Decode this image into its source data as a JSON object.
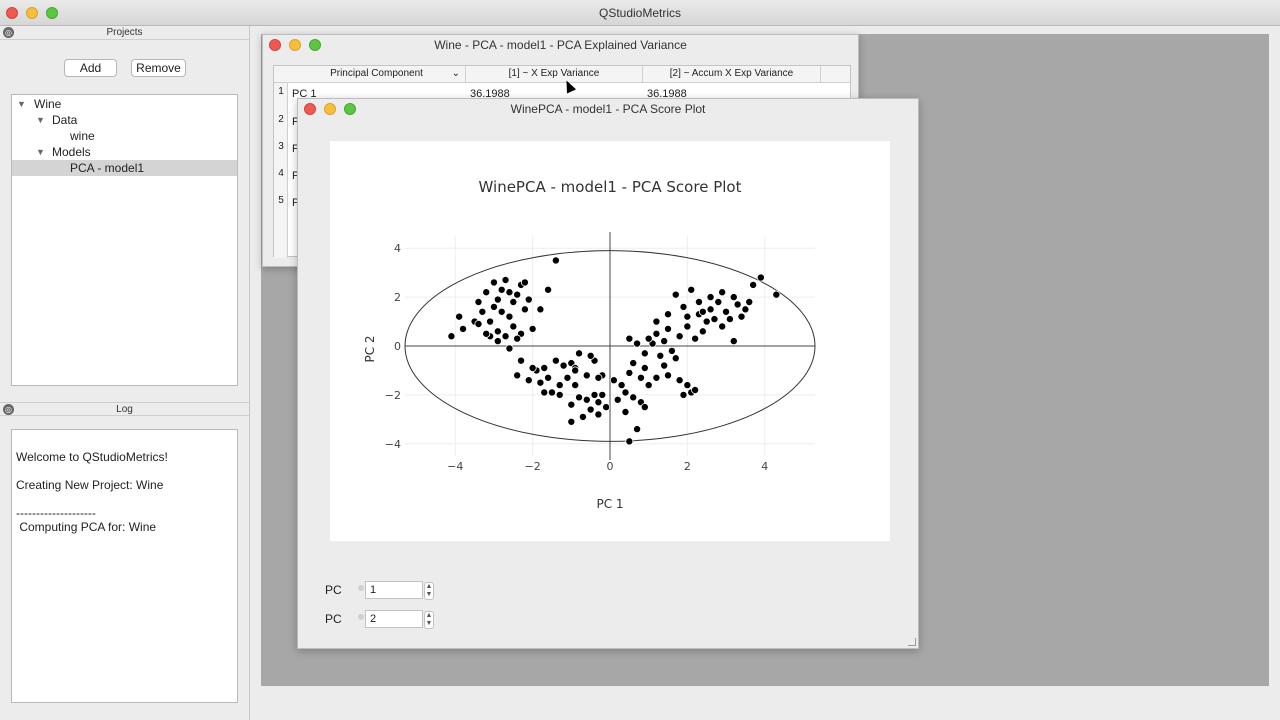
{
  "app": {
    "title": "QStudioMetrics"
  },
  "projects_panel": {
    "title": "Projects",
    "add_label": "Add",
    "remove_label": "Remove",
    "tree": [
      {
        "label": "Wine",
        "depth": 0,
        "expanded": true
      },
      {
        "label": "Data",
        "depth": 1,
        "expanded": true
      },
      {
        "label": "wine",
        "depth": 2
      },
      {
        "label": "Models",
        "depth": 1,
        "expanded": true
      },
      {
        "label": "PCA - model1",
        "depth": 2,
        "selected": true
      }
    ]
  },
  "log_panel": {
    "title": "Log",
    "lines": [
      "Welcome to QStudioMetrics!",
      "Creating New Project: Wine",
      "--------------------",
      " Computing PCA for: Wine"
    ]
  },
  "variance_window": {
    "title": "Wine - PCA - model1 - PCA Explained Variance",
    "columns": [
      "Principal Component",
      "[1] ~ X Exp Variance",
      "[2] ~ Accum X Exp Variance"
    ],
    "rows": [
      {
        "num": "1",
        "pc": "PC 1",
        "x": "36.1988",
        "accum": "36.1988"
      },
      {
        "num": "2",
        "pc": "P"
      },
      {
        "num": "3",
        "pc": "P"
      },
      {
        "num": "4",
        "pc": "P"
      },
      {
        "num": "5",
        "pc": "P"
      }
    ]
  },
  "score_window": {
    "title": "WinePCA - model1 - PCA Score Plot",
    "pc_label_1": "PC",
    "pc_value_1": "1",
    "pc_label_2": "PC",
    "pc_value_2": "2"
  },
  "chart_data": {
    "type": "scatter",
    "title": "WinePCA - model1 - PCA Score Plot",
    "xlabel": "PC 1",
    "ylabel": "PC 2",
    "xlim": [
      -5.3,
      5.3
    ],
    "ylim": [
      -4.5,
      4.5
    ],
    "xticks": [
      -4,
      -2,
      0,
      2,
      4
    ],
    "yticks": [
      -4,
      -2,
      0,
      2,
      4
    ],
    "ellipse": {
      "cx": 0,
      "cy": 0,
      "rx": 5.3,
      "ry": 3.9
    },
    "marker_color": "#000000",
    "points": [
      [
        -3.8,
        0.7
      ],
      [
        -3.9,
        1.2
      ],
      [
        -3.5,
        1.0
      ],
      [
        -3.4,
        1.8
      ],
      [
        -3.3,
        1.4
      ],
      [
        -3.2,
        2.2
      ],
      [
        -3.1,
        1.0
      ],
      [
        -3.0,
        2.6
      ],
      [
        -2.9,
        1.9
      ],
      [
        -2.8,
        1.4
      ],
      [
        -2.7,
        2.7
      ],
      [
        -2.6,
        2.2
      ],
      [
        -2.5,
        1.8
      ],
      [
        -2.4,
        2.1
      ],
      [
        -2.3,
        2.5
      ],
      [
        -2.2,
        1.5
      ],
      [
        -2.1,
        1.9
      ],
      [
        -2.6,
        1.2
      ],
      [
        -2.5,
        0.8
      ],
      [
        -2.9,
        0.6
      ],
      [
        -3.1,
        0.4
      ],
      [
        -2.7,
        0.4
      ],
      [
        -2.3,
        0.5
      ],
      [
        -2.0,
        0.7
      ],
      [
        -1.8,
        1.5
      ],
      [
        -1.6,
        2.3
      ],
      [
        -2.4,
        0.3
      ],
      [
        -2.9,
        0.2
      ],
      [
        -3.2,
        0.5
      ],
      [
        -4.1,
        0.4
      ],
      [
        -2.6,
        -0.1
      ],
      [
        -2.3,
        -0.6
      ],
      [
        -2.4,
        -1.2
      ],
      [
        -1.9,
        -1.0
      ],
      [
        -1.8,
        -1.5
      ],
      [
        -1.6,
        -1.3
      ],
      [
        -1.7,
        -0.9
      ],
      [
        -1.4,
        -0.6
      ],
      [
        -1.2,
        -0.8
      ],
      [
        -1.5,
        -1.9
      ],
      [
        -1.3,
        -1.6
      ],
      [
        -1.1,
        -1.3
      ],
      [
        -0.9,
        -1.6
      ],
      [
        -0.8,
        -2.1
      ],
      [
        -1.0,
        -2.4
      ],
      [
        -0.6,
        -2.2
      ],
      [
        -0.5,
        -2.6
      ],
      [
        -0.4,
        -2.0
      ],
      [
        -0.3,
        -2.3
      ],
      [
        -0.2,
        -2.0
      ],
      [
        -0.1,
        -2.5
      ],
      [
        -0.6,
        -1.2
      ],
      [
        -0.4,
        -0.6
      ],
      [
        -0.2,
        -1.2
      ],
      [
        -0.8,
        -0.3
      ],
      [
        -1.0,
        -0.7
      ],
      [
        -0.3,
        -2.8
      ],
      [
        -0.7,
        -2.9
      ],
      [
        -1.0,
        -3.1
      ],
      [
        -0.9,
        -0.9
      ],
      [
        0.1,
        -1.4
      ],
      [
        0.3,
        -1.6
      ],
      [
        0.5,
        -1.1
      ],
      [
        0.6,
        -0.7
      ],
      [
        0.8,
        -1.3
      ],
      [
        0.9,
        -0.9
      ],
      [
        1.0,
        -1.6
      ],
      [
        0.8,
        -2.3
      ],
      [
        0.6,
        -2.1
      ],
      [
        0.9,
        -2.5
      ],
      [
        0.4,
        -2.7
      ],
      [
        0.2,
        -2.2
      ],
      [
        1.2,
        -1.3
      ],
      [
        1.4,
        -0.8
      ],
      [
        1.5,
        -1.2
      ],
      [
        1.7,
        -0.5
      ],
      [
        1.8,
        -1.4
      ],
      [
        2.0,
        -1.6
      ],
      [
        2.1,
        -1.9
      ],
      [
        1.9,
        -2.0
      ],
      [
        2.2,
        -1.8
      ],
      [
        1.6,
        -0.2
      ],
      [
        1.3,
        -0.4
      ],
      [
        1.1,
        0.1
      ],
      [
        1.0,
        0.3
      ],
      [
        1.2,
        0.5
      ],
      [
        1.4,
        0.2
      ],
      [
        1.5,
        0.7
      ],
      [
        1.8,
        0.4
      ],
      [
        2.0,
        0.8
      ],
      [
        2.2,
        0.3
      ],
      [
        2.4,
        0.6
      ],
      [
        2.5,
        1.0
      ],
      [
        2.3,
        1.3
      ],
      [
        2.6,
        1.5
      ],
      [
        2.8,
        1.8
      ],
      [
        3.0,
        1.4
      ],
      [
        2.7,
        1.1
      ],
      [
        2.9,
        0.8
      ],
      [
        3.1,
        1.1
      ],
      [
        3.3,
        1.7
      ],
      [
        3.5,
        1.5
      ],
      [
        3.4,
        1.2
      ],
      [
        3.2,
        2.0
      ],
      [
        2.9,
        2.2
      ],
      [
        2.6,
        2.0
      ],
      [
        2.3,
        1.8
      ],
      [
        2.1,
        2.3
      ],
      [
        1.9,
        1.6
      ],
      [
        1.7,
        2.1
      ],
      [
        1.5,
        1.3
      ],
      [
        1.2,
        1.0
      ],
      [
        2.0,
        1.2
      ],
      [
        2.4,
        1.4
      ],
      [
        3.6,
        1.8
      ],
      [
        3.7,
        2.5
      ],
      [
        3.9,
        2.8
      ],
      [
        4.3,
        2.1
      ],
      [
        3.2,
        0.2
      ],
      [
        0.5,
        0.3
      ],
      [
        0.7,
        0.1
      ],
      [
        0.9,
        -0.3
      ],
      [
        -0.5,
        -0.4
      ],
      [
        -0.9,
        -1.0
      ],
      [
        -1.3,
        -2.0
      ],
      [
        -1.7,
        -1.9
      ],
      [
        -2.1,
        -1.4
      ],
      [
        -2.0,
        -0.9
      ],
      [
        -3.4,
        0.9
      ],
      [
        -3.0,
        1.6
      ],
      [
        -2.8,
        2.3
      ],
      [
        -2.2,
        2.6
      ],
      [
        -1.4,
        3.5
      ],
      [
        0.5,
        -3.9
      ],
      [
        0.7,
        -3.4
      ],
      [
        -0.3,
        -1.3
      ],
      [
        0.4,
        -1.9
      ]
    ]
  }
}
